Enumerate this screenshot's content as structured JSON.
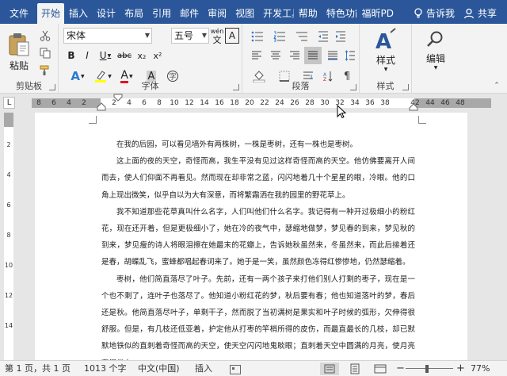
{
  "tabs": {
    "file": "文件",
    "home": "开始",
    "insert": "插入",
    "design": "设计",
    "layout": "布局",
    "references": "引用",
    "mailings": "邮件",
    "review": "审阅",
    "view": "视图",
    "developer": "开发工具",
    "help": "帮助",
    "special": "特色功能",
    "foxit": "福昕PD",
    "tell_me": "告诉我",
    "share": "共享"
  },
  "ribbon": {
    "clipboard": {
      "label": "剪贴板",
      "paste": "粘贴"
    },
    "font": {
      "label": "字体",
      "font_name": "宋体",
      "font_size": "五号",
      "bold": "B",
      "italic": "I",
      "underline": "U",
      "strike": "abc",
      "subscript": "x₂",
      "superscript": "x²",
      "wen": "wén",
      "phonetic_char": "文",
      "char_border": "A",
      "char_shade": "A"
    },
    "paragraph": {
      "label": "段落"
    },
    "styles": {
      "label": "样式",
      "button": "样式"
    },
    "editing": {
      "label": "",
      "button": "编辑"
    }
  },
  "ruler": {
    "numbers": [
      "8",
      "6",
      "4",
      "2",
      "",
      "2",
      "4",
      "6",
      "8",
      "10",
      "12",
      "14",
      "16",
      "18",
      "20",
      "22",
      "24",
      "26",
      "28",
      "30",
      "32",
      "34",
      "36",
      "38",
      "",
      "42",
      "44",
      "46",
      "48"
    ],
    "vertical_numbers": [
      "2",
      "4",
      "6",
      "8",
      "10",
      "12",
      "14"
    ]
  },
  "document": {
    "paragraphs": [
      "在我的后园，可以看见墙外有两株树，一株是枣树，还有一株也是枣树。",
      "这上面的夜的天空，奇怪而高，我生平没有见过这样奇怪而高的天空。他仿佛要离开人间而去，使人们仰面不再看见。然而现在却非常之蓝，闪闪地着几十个星星的眼，冷眼。他的口角上现出微笑，似乎自以为大有深意，而将繁霜洒在我的园里的野花草上。",
      "我不知道那些花草真叫什么名字，人们叫他们什么名字。我记得有一种开过极细小的粉红花，现在还开着，但是更极细小了，她在冷的夜气中，瑟缩地做梦，梦见春的到来，梦见秋的到来，梦见瘦的诗人将眼泪擦在她最末的花瓣上，告诉她秋虽然来，冬虽然来，而此后接着还是春，胡蝶乱飞，蜜蜂都唱起春词来了。她于是一笑，虽然颜色冻得红惨惨地，仍然瑟缩着。",
      "枣树，他们简直落尽了叶子。先前，还有一两个孩子来打他们别人打剩的枣子，现在是一个也不剩了，连叶子也落尽了。他知道小粉红花的梦，秋后要有春；他也知道落叶的梦，春后还是秋。他简直落尽叶子，单剩干子，然而脱了当初满树是果实和叶子时候的弧形，欠伸得很舒服。但是，有几枝还低亚着，护定他从打枣的竿梢所得的皮伤，而最直最长的几枝，却已默默地铁似的直刺着奇怪而高的天空，使天空闪闪地鬼睒眼；直刺着天空中圆满的月亮，使月亮窘得发白。"
    ]
  },
  "status": {
    "page": "第 1 页，共 1 页",
    "words": "1013 个字",
    "language": "中文(中国)",
    "mode": "插入",
    "zoom": "77%",
    "zoom_minus": "−",
    "zoom_plus": "+"
  },
  "colors": {
    "accent": "#2b579a",
    "highlight": "#ffff00",
    "font_color": "#e81123"
  }
}
